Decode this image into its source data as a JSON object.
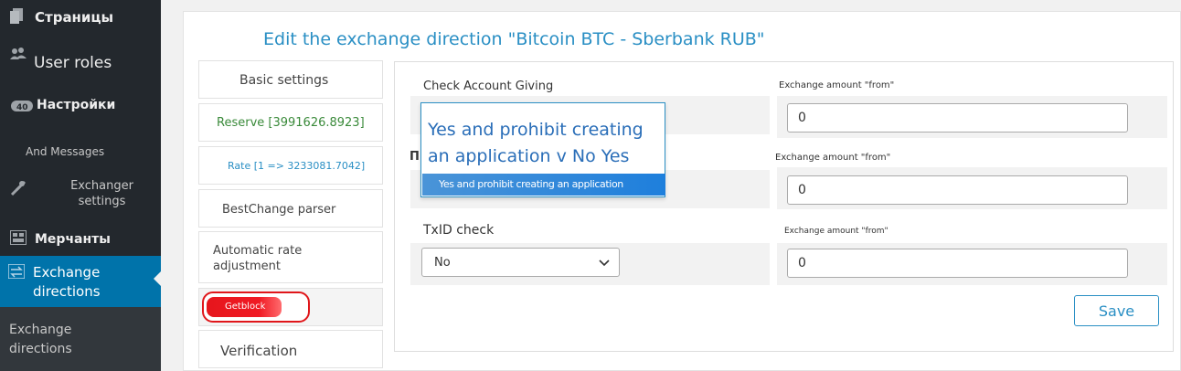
{
  "sidebar": {
    "items": [
      {
        "label": "Страницы",
        "icon": "pages-icon"
      },
      {
        "label": "User roles",
        "icon": "users-icon"
      },
      {
        "label": "Настройки",
        "icon": "settings-icon"
      },
      {
        "label": "And Messages"
      },
      {
        "label": "Exchanger settings",
        "icon": "wrench-icon"
      },
      {
        "label": "Мерчанты",
        "icon": "merchants-icon"
      },
      {
        "label": "Exchange directions",
        "icon": "exchange-icon"
      },
      {
        "label": "Exchange directions"
      }
    ]
  },
  "page": {
    "title": "Edit the exchange direction \"Bitcoin BTC - Sberbank RUB\""
  },
  "tabs": [
    {
      "label": "Basic settings"
    },
    {
      "label": "Reserve [3991626.8923]"
    },
    {
      "label": "Rate [1 => 3233081.7042]"
    },
    {
      "label": "BestChange parser"
    },
    {
      "label": "Automatic rate adjustment"
    },
    {
      "label": "Getblock"
    },
    {
      "label": "Verification"
    }
  ],
  "form": {
    "row1": {
      "label": "Check Account Giving",
      "amount_label": "Exchange amount \"from\"",
      "amount_value": "0"
    },
    "row2": {
      "label_partial": "П",
      "amount_label": "Exchange amount \"from\"",
      "amount_value": "0"
    },
    "row3": {
      "label": "TxID check",
      "select_value": "No",
      "amount_label": "Exchange amount \"from\"",
      "amount_value": "0"
    },
    "save_label": "Save"
  },
  "dropdown": {
    "text": "Yes and prohibit creating an application v No Yes",
    "highlight_option": "Yes and prohibit creating an application"
  },
  "colors": {
    "sidebar_bg": "#23282d",
    "active_bg": "#0073aa",
    "accent": "#2a8fc4",
    "reserve_green": "#3a8a3a",
    "rate_blue": "#2a8fc4",
    "getblock_red": "#e0161a"
  }
}
